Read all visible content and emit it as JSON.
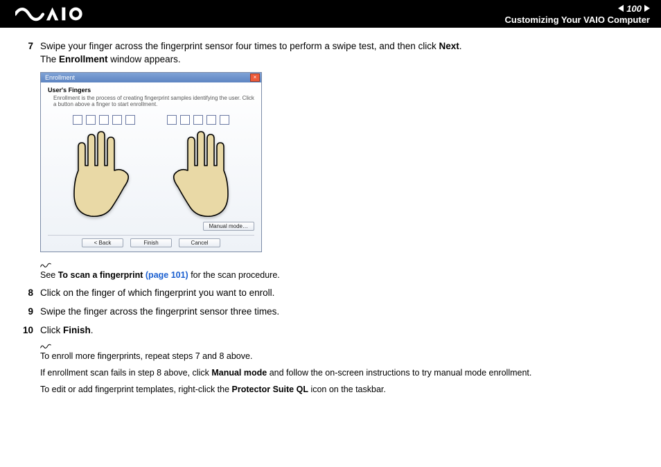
{
  "header": {
    "page_number": "100",
    "section": "Customizing Your VAIO Computer"
  },
  "steps": {
    "s7": {
      "num": "7",
      "line1_pre": "Swipe your finger across the fingerprint sensor four times to perform a swipe test, and then click ",
      "line1_bold": "Next",
      "line1_post": ".",
      "line2_pre": "The ",
      "line2_bold": "Enrollment",
      "line2_post": " window appears."
    },
    "s8": {
      "num": "8",
      "text": "Click on the finger of which fingerprint you want to enroll."
    },
    "s9": {
      "num": "9",
      "text": "Swipe the finger across the fingerprint sensor three times."
    },
    "s10": {
      "num": "10",
      "text_pre": "Click ",
      "text_bold": "Finish",
      "text_post": "."
    }
  },
  "enrollment_window": {
    "title": "Enrollment",
    "section_title": "User's Fingers",
    "section_desc": "Enrollment is the process of creating fingerprint samples identifying the user. Click a button above a finger to start enrollment.",
    "manual_button": "Manual mode…",
    "back_button": "< Back",
    "finish_button": "Finish",
    "cancel_button": "Cancel"
  },
  "notes": {
    "n1_pre": "See ",
    "n1_bold": "To scan a fingerprint ",
    "n1_link": "(page 101)",
    "n1_post": " for the scan procedure.",
    "n2": "To enroll more fingerprints, repeat steps 7 and 8 above.",
    "n3_pre": "If enrollment scan fails in step 8 above, click ",
    "n3_bold": "Manual mode",
    "n3_post": " and follow the on-screen instructions to try manual mode enrollment.",
    "n4_pre": "To edit or add fingerprint templates, right-click the ",
    "n4_bold": "Protector Suite QL",
    "n4_post": " icon on the taskbar."
  }
}
